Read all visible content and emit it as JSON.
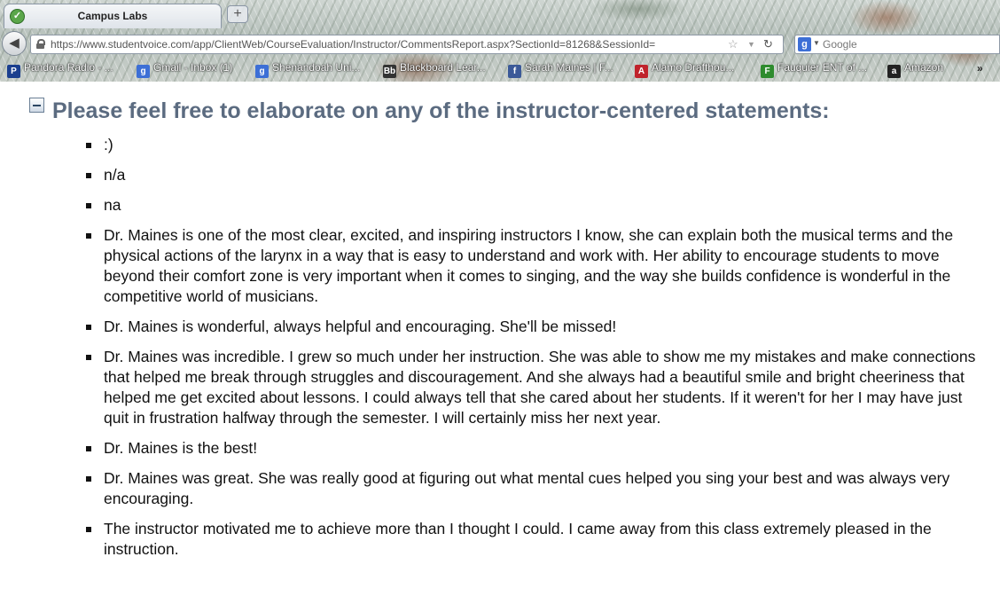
{
  "browser": {
    "tab": {
      "title": "Campus Labs",
      "favicon": "check-icon"
    },
    "new_tab_symbol": "+",
    "url": "https://www.studentvoice.com/app/ClientWeb/CourseEvaluation/Instructor/CommentsReport.aspx?SectionId=81268&SessionId=",
    "search_placeholder": "Google",
    "bookmarks": [
      {
        "label": "Pandora Radio - ...",
        "icon": "pandora-icon",
        "color": "#1b3f8f"
      },
      {
        "label": "Gmail - Inbox (1)",
        "icon": "google-icon",
        "color": "#3d6fd6"
      },
      {
        "label": "Shenandoah Uni...",
        "icon": "google-icon",
        "color": "#3d6fd6"
      },
      {
        "label": "Blackboard Lear...",
        "icon": "blackboard-icon",
        "color": "#333333"
      },
      {
        "label": "Sarah Maines | F...",
        "icon": "facebook-icon",
        "color": "#3b5998"
      },
      {
        "label": "Alamo Drafthou...",
        "icon": "alamo-icon",
        "color": "#c0232c"
      },
      {
        "label": "Fauquier ENT of ...",
        "icon": "fauquier-icon",
        "color": "#2e8b2e"
      },
      {
        "label": "Amazon",
        "icon": "amazon-icon",
        "color": "#222222"
      }
    ],
    "more_bookmarks": "»"
  },
  "page": {
    "heading": "Please feel free to elaborate on any of the instructor-centered statements:",
    "comments": [
      ":)",
      "n/a",
      "na",
      "Dr. Maines is one of the most clear, excited, and inspiring instructors I know, she can explain both the musical terms and the physical actions of the larynx in a way that is easy to understand and work with. Her ability to encourage students to move beyond their comfort zone is very important when it comes to singing, and the way she builds confidence is wonderful in the competitive world of musicians.",
      "Dr. Maines is wonderful, always helpful and encouraging. She'll be missed!",
      "Dr. Maines was incredible. I grew so much under her instruction. She was able to show me my mistakes and make connections that helped me break through struggles and discouragement. And she always had a beautiful smile and bright cheeriness that helped me get excited about lessons. I could always tell that she cared about her students. If it weren't for her I may have just quit in frustration halfway through the semester. I will certainly miss her next year.",
      "Dr. Maines is the best!",
      "Dr. Maines was great. She was really good at figuring out what mental cues helped you sing your best and was always very encouraging.",
      "The instructor motivated me to achieve more than I thought I could. I came away from this class extremely pleased in the instruction."
    ]
  },
  "colors": {
    "heading": "#5b6b80",
    "text": "#111111"
  }
}
